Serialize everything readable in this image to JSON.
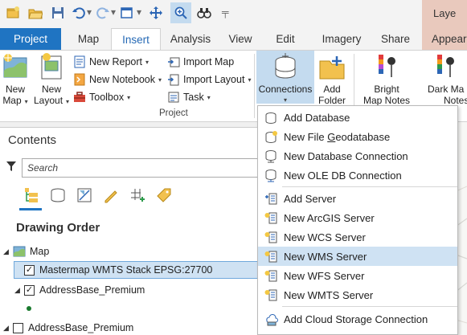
{
  "title_tab": "Laye",
  "tabs": [
    {
      "label": "Project"
    },
    {
      "label": "Map"
    },
    {
      "label": "Insert"
    },
    {
      "label": "Analysis"
    },
    {
      "label": "View"
    },
    {
      "label": "Edit"
    },
    {
      "label": "Imagery"
    },
    {
      "label": "Share"
    },
    {
      "label": "Appeara"
    }
  ],
  "ribbon": {
    "new_map": {
      "line1": "New",
      "line2": "Map"
    },
    "new_layout": {
      "line1": "New",
      "line2": "Layout"
    },
    "new_report": "New Report",
    "new_notebook": "New Notebook",
    "toolbox": "Toolbox",
    "import_map": "Import Map",
    "import_layout": "Import Layout",
    "task": "Task",
    "connections": "Connections",
    "add_folder": {
      "line1": "Add",
      "line2": "Folder"
    },
    "bright_map_notes": {
      "line1": "Bright",
      "line2": "Map Notes"
    },
    "dark_map_notes": {
      "line1": "Dark Ma",
      "line2": "Notes"
    },
    "group_project": "Project"
  },
  "contents": {
    "title": "Contents",
    "search_placeholder": "Search",
    "drawing_order": "Drawing Order",
    "layers": [
      {
        "label": "Map"
      },
      {
        "label": "Mastermap WMTS Stack EPSG:27700"
      },
      {
        "label": "AddressBase_Premium"
      },
      {
        "label": "AddressBase_Premium"
      }
    ]
  },
  "menu": {
    "items": [
      {
        "label": "Add Database"
      },
      {
        "label_pre": "New File ",
        "label_u": "G",
        "label_post": "eodatabase"
      },
      {
        "label": "New Database Connection"
      },
      {
        "label": "New OLE DB Connection"
      },
      {
        "label": "Add Server"
      },
      {
        "label": "New ArcGIS Server"
      },
      {
        "label": "New WCS Server"
      },
      {
        "label": "New WMS Server"
      },
      {
        "label": "New WFS Server"
      },
      {
        "label": "New WMTS Server"
      },
      {
        "label": "Add Cloud Storage Connection"
      }
    ],
    "highlighted": "New WMS Server"
  },
  "colors": {
    "accent": "#1f74c2",
    "highlight": "#cfe2f3",
    "pressed": "#c4dbef",
    "title_tab": "#e9c9bd"
  }
}
